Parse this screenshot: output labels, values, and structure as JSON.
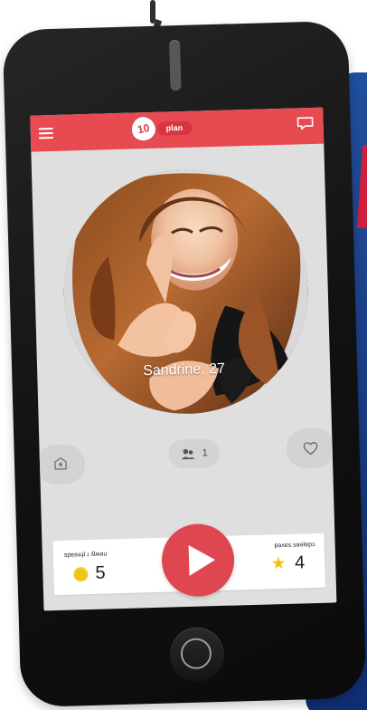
{
  "app": {
    "logo_number": "10",
    "logo_text": "plan"
  },
  "profile": {
    "name_age": "Sandrine, 27"
  },
  "actions": {
    "matches_count": "1"
  },
  "stats": {
    "left_label": "spɐǝɹɥʇ ɹ ʎlʍǝu",
    "left_value": "5",
    "right_label": "pǝʌɐs sǝǝʇɐpɔ",
    "right_value": "4"
  },
  "colors": {
    "primary": "#e74b51",
    "accent_red": "#df4750",
    "screen_bg": "#dfdfdf",
    "coin": "#f1c40f",
    "star": "#f2c21a"
  },
  "icons": {
    "menu": "menu-icon",
    "chat": "chat-icon",
    "left_action": "profile-icon",
    "matches": "people-icon",
    "favorite": "heart-icon",
    "play": "play-icon",
    "home": "home-button-icon"
  }
}
